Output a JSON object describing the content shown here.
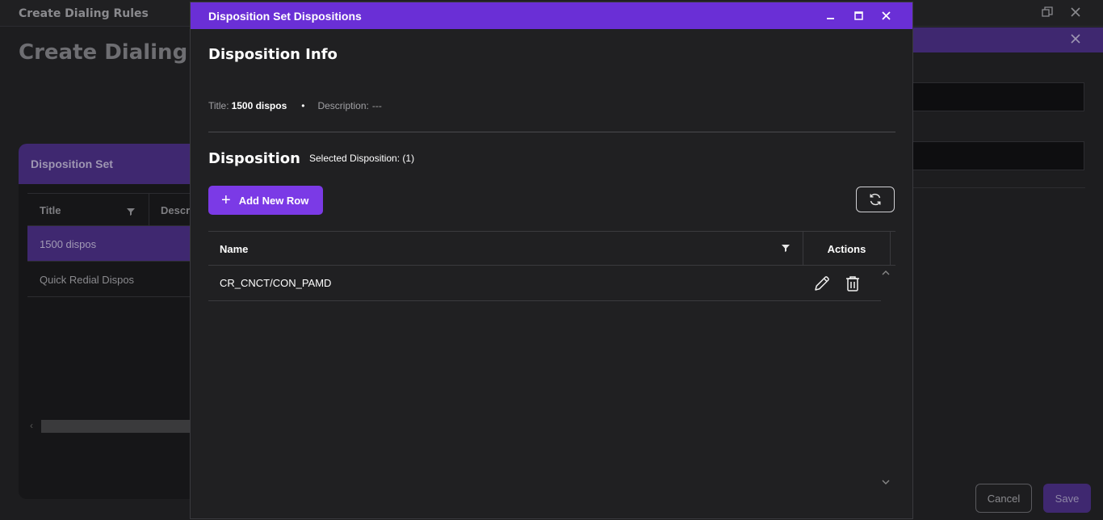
{
  "background": {
    "window_title": "Create Dialing Rules",
    "heading": "Create Dialing Rules",
    "panel": {
      "title": "Disposition Set",
      "columns": [
        "Title",
        "Descr"
      ],
      "rows": [
        "1500 dispos",
        "Quick Redial Dispos"
      ]
    },
    "cancel_label": "Cancel",
    "save_label": "Save"
  },
  "modal": {
    "title": "Disposition Set Dispositions",
    "info_heading": "Disposition Info",
    "info": {
      "title_label": "Title:",
      "title_value": "1500 dispos",
      "description_label": "Description:",
      "description_value": "---"
    },
    "disposition_heading": "Disposition",
    "selected_text": "Selected Disposition: (1)",
    "add_row_label": "Add New Row",
    "grid": {
      "columns": {
        "name": "Name",
        "actions": "Actions"
      },
      "rows": [
        {
          "name": "CR_CNCT/CON_PAMD"
        }
      ]
    }
  },
  "icons": {
    "minimize": "minimize-icon",
    "maximize": "maximize-icon",
    "close": "close-icon",
    "refresh": "refresh-icon",
    "filter": "filter-icon",
    "edit": "pencil-icon",
    "delete": "trash-icon"
  },
  "colors": {
    "accent": "#6a2fd6",
    "button": "#7b3ae6",
    "bg": "#202022"
  }
}
